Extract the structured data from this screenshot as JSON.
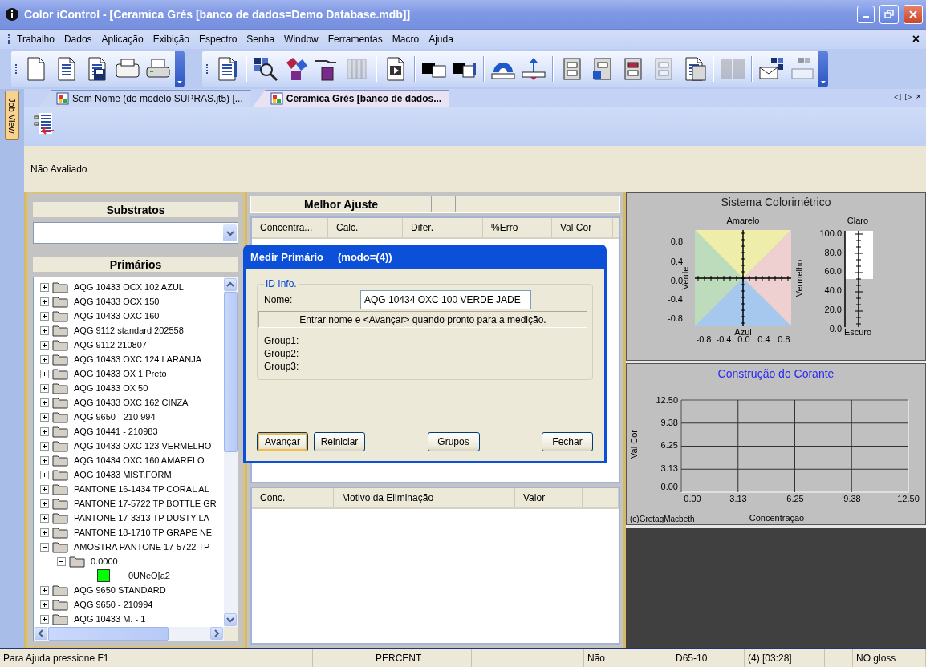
{
  "window": {
    "title": "Color iControl - [Ceramica Grés [banco de dados=Demo Database.mdb]]"
  },
  "menu": [
    "Trabalho",
    "Dados",
    "Aplicação",
    "Exibição",
    "Espectro",
    "Senha",
    "Window",
    "Ferramentas",
    "Macro",
    "Ajuda"
  ],
  "menu_close": "×",
  "toolbar_buttons": [
    {
      "disabled": false
    },
    {
      "disabled": false
    },
    {
      "disabled": false
    },
    {
      "disabled": false
    },
    {
      "disabled": false
    },
    {
      "disabled": false
    },
    {
      "disabled": false
    },
    {
      "disabled": false
    },
    {
      "disabled": false
    },
    {
      "disabled": true
    },
    {
      "disabled": false
    },
    {
      "disabled": false
    },
    {
      "disabled": false
    },
    {
      "disabled": false
    },
    {
      "disabled": false
    },
    {
      "disabled": false
    },
    {
      "disabled": false
    },
    {
      "disabled": false
    },
    {
      "disabled": true
    },
    {
      "disabled": false
    },
    {
      "disabled": true
    },
    {
      "disabled": false
    },
    {
      "disabled": true
    }
  ],
  "side_tab": "Job View",
  "tabs": [
    {
      "label": "Sem Nome (do modelo SUPRAS.jt5) [...",
      "selected": false
    },
    {
      "label": "Ceramica Grés [banco de dados...",
      "selected": true
    }
  ],
  "tab_controls": [
    "◁",
    "▷",
    "×"
  ],
  "status_text": "Não Avaliado",
  "substratos": {
    "title": "Substratos"
  },
  "primarios": {
    "title": "Primários",
    "items": [
      {
        "kind": "folder",
        "label": "AQG 10433 OCX 102 AZUL",
        "expanded": false
      },
      {
        "kind": "folder",
        "label": "AQG 10433 OCX 150",
        "expanded": false
      },
      {
        "kind": "folder",
        "label": "AQG 10433 OXC 160",
        "expanded": false
      },
      {
        "kind": "folder",
        "label": "AQG 9112 standard 202558",
        "expanded": false
      },
      {
        "kind": "folder",
        "label": "AQG 9112 210807",
        "expanded": false
      },
      {
        "kind": "folder",
        "label": "AQG 10433 OXC 124 LARANJA",
        "expanded": false
      },
      {
        "kind": "folder",
        "label": "AQG 10433 OX 1 Preto",
        "expanded": false
      },
      {
        "kind": "folder",
        "label": "AQG 10433 OX 50",
        "expanded": false
      },
      {
        "kind": "folder",
        "label": "AQG 10433 OXC 162 CINZA",
        "expanded": false
      },
      {
        "kind": "folder",
        "label": "AQG 9650 - 210 994",
        "expanded": false
      },
      {
        "kind": "folder",
        "label": "AQG 10441 - 210983",
        "expanded": false
      },
      {
        "kind": "folder",
        "label": "AQG 10433 OXC 123 VERMELHO",
        "expanded": false
      },
      {
        "kind": "folder",
        "label": "AQG 10434 OXC 160 AMARELO",
        "expanded": false
      },
      {
        "kind": "folder",
        "label": "AQG 10433 MIST.FORM",
        "expanded": false
      },
      {
        "kind": "folder",
        "label": "PANTONE 16-1434 TP CORAL AL",
        "expanded": false
      },
      {
        "kind": "folder",
        "label": "PANTONE 17-5722 TP BOTTLE GR",
        "expanded": false
      },
      {
        "kind": "folder",
        "label": "PANTONE 17-3313 TP DUSTY LA",
        "expanded": false
      },
      {
        "kind": "folder",
        "label": "PANTONE 18-1710 TP GRAPE NE",
        "expanded": false
      },
      {
        "kind": "folder",
        "label": "AMOSTRA PANTONE 17-5722 TP",
        "expanded": true,
        "children": [
          {
            "kind": "folder",
            "label": "0.0000",
            "expanded": true,
            "children": [
              {
                "kind": "sample",
                "label": "0UNeO[a2",
                "color": "#00ff00"
              }
            ]
          }
        ]
      },
      {
        "kind": "folder",
        "label": "AQG 9650 STANDARD",
        "expanded": false
      },
      {
        "kind": "folder",
        "label": "AQG 9650 - 210994",
        "expanded": false
      },
      {
        "kind": "folder",
        "label": "AQG 10433 M. - 1",
        "expanded": false
      }
    ]
  },
  "melhor_ajuste": {
    "title": "Melhor Ajuste",
    "columns": [
      "Concentra...",
      "Calc.",
      "Difer.",
      "%Erro",
      "Val Cor"
    ]
  },
  "eliminacao": {
    "columns": [
      "Conc.",
      "Motivo da Eliminação",
      "Valor"
    ]
  },
  "colorimetric": {
    "title": "Sistema Colorimétrico",
    "top": "Amarelo",
    "bottom": "Azul",
    "left": "Verde",
    "right": "Vermelho",
    "y_ticks": [
      "0.8",
      "0.4",
      "0.0",
      "-0.4",
      "-0.8"
    ],
    "x_ticks": [
      "-0.8",
      "-0.4",
      "0.0",
      "0.4",
      "0.8"
    ],
    "lightness": {
      "top": "Claro",
      "bottom": "Escuro",
      "ticks": [
        "100.0",
        "80.0",
        "60.0",
        "40.0",
        "20.0",
        "0.0"
      ],
      "level": 0.5
    }
  },
  "build_chart": {
    "title": "Construção do Corante",
    "y_label": "Val Cor",
    "x_label": "Concentração",
    "credit": "(c)GretagMacbeth",
    "y_ticks": [
      "12.50",
      "9.38",
      "6.25",
      "3.13",
      "0.00"
    ],
    "x_ticks": [
      "0.00",
      "3.13",
      "6.25",
      "9.38",
      "12.50"
    ]
  },
  "dialog": {
    "title": "Medir Primário",
    "mode": "(modo=(4))",
    "group": "ID Info.",
    "name_label": "Nome:",
    "name_value": "AQG 10434 OXC 100 VERDE JADE",
    "hint": "Entrar nome e <Avançar> quando pronto para a medição.",
    "groups": [
      "Group1:",
      "Group2:",
      "Group3:"
    ],
    "buttons": [
      {
        "label": "Avançar",
        "focused": true
      },
      {
        "label": "Reiniciar",
        "focused": false
      },
      {
        "label": "Grupos",
        "focused": false
      },
      {
        "label": "Fechar",
        "focused": false
      }
    ]
  },
  "status_bar": [
    "Para Ajuda pressione F1",
    "PERCENT",
    "Não",
    "D65-10",
    "(4) [03:28]",
    "NO gloss"
  ]
}
